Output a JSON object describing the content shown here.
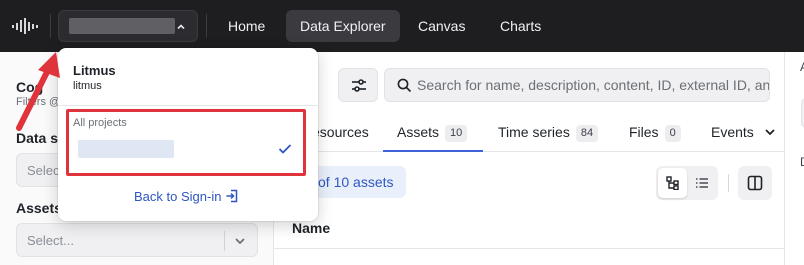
{
  "topbar": {
    "logo_icon": "cognite-logo-icon",
    "project_selector": {
      "chevron": "chevron-up-icon"
    },
    "nav": [
      {
        "label": "Home",
        "active": false
      },
      {
        "label": "Data Explorer",
        "active": true
      },
      {
        "label": "Canvas",
        "active": false
      },
      {
        "label": "Charts",
        "active": false
      }
    ]
  },
  "sidebar": {
    "title_fragment": "Cog",
    "subtitle_fragment": "Filters @",
    "data_set_label": "Data se",
    "data_set_placeholder": "Selec",
    "assets_label": "Assets",
    "assets_placeholder": "Select..."
  },
  "main": {
    "search_placeholder": "Search for name, description, content, ID, external ID, and",
    "tabs": [
      {
        "label": "esources",
        "count": ""
      },
      {
        "label": "Assets",
        "count": "10"
      },
      {
        "label": "Time series",
        "count": "84"
      },
      {
        "label": "Files",
        "count": "0"
      },
      {
        "label": "Events",
        "count": ""
      }
    ],
    "result_count": "of 10 assets",
    "column_header": "Name"
  },
  "right_panel": {
    "top_letter": "A",
    "bottom_letter": "D"
  },
  "dropdown": {
    "org_name": "Litmus",
    "org_id": "litmus",
    "section_label": "All projects",
    "back_label": "Back to Sign-in"
  },
  "annotation": {
    "color": "#e0343c"
  },
  "colors": {
    "accent": "#3e62d8",
    "topbar": "#1e1e20",
    "link": "#2e57c4"
  }
}
